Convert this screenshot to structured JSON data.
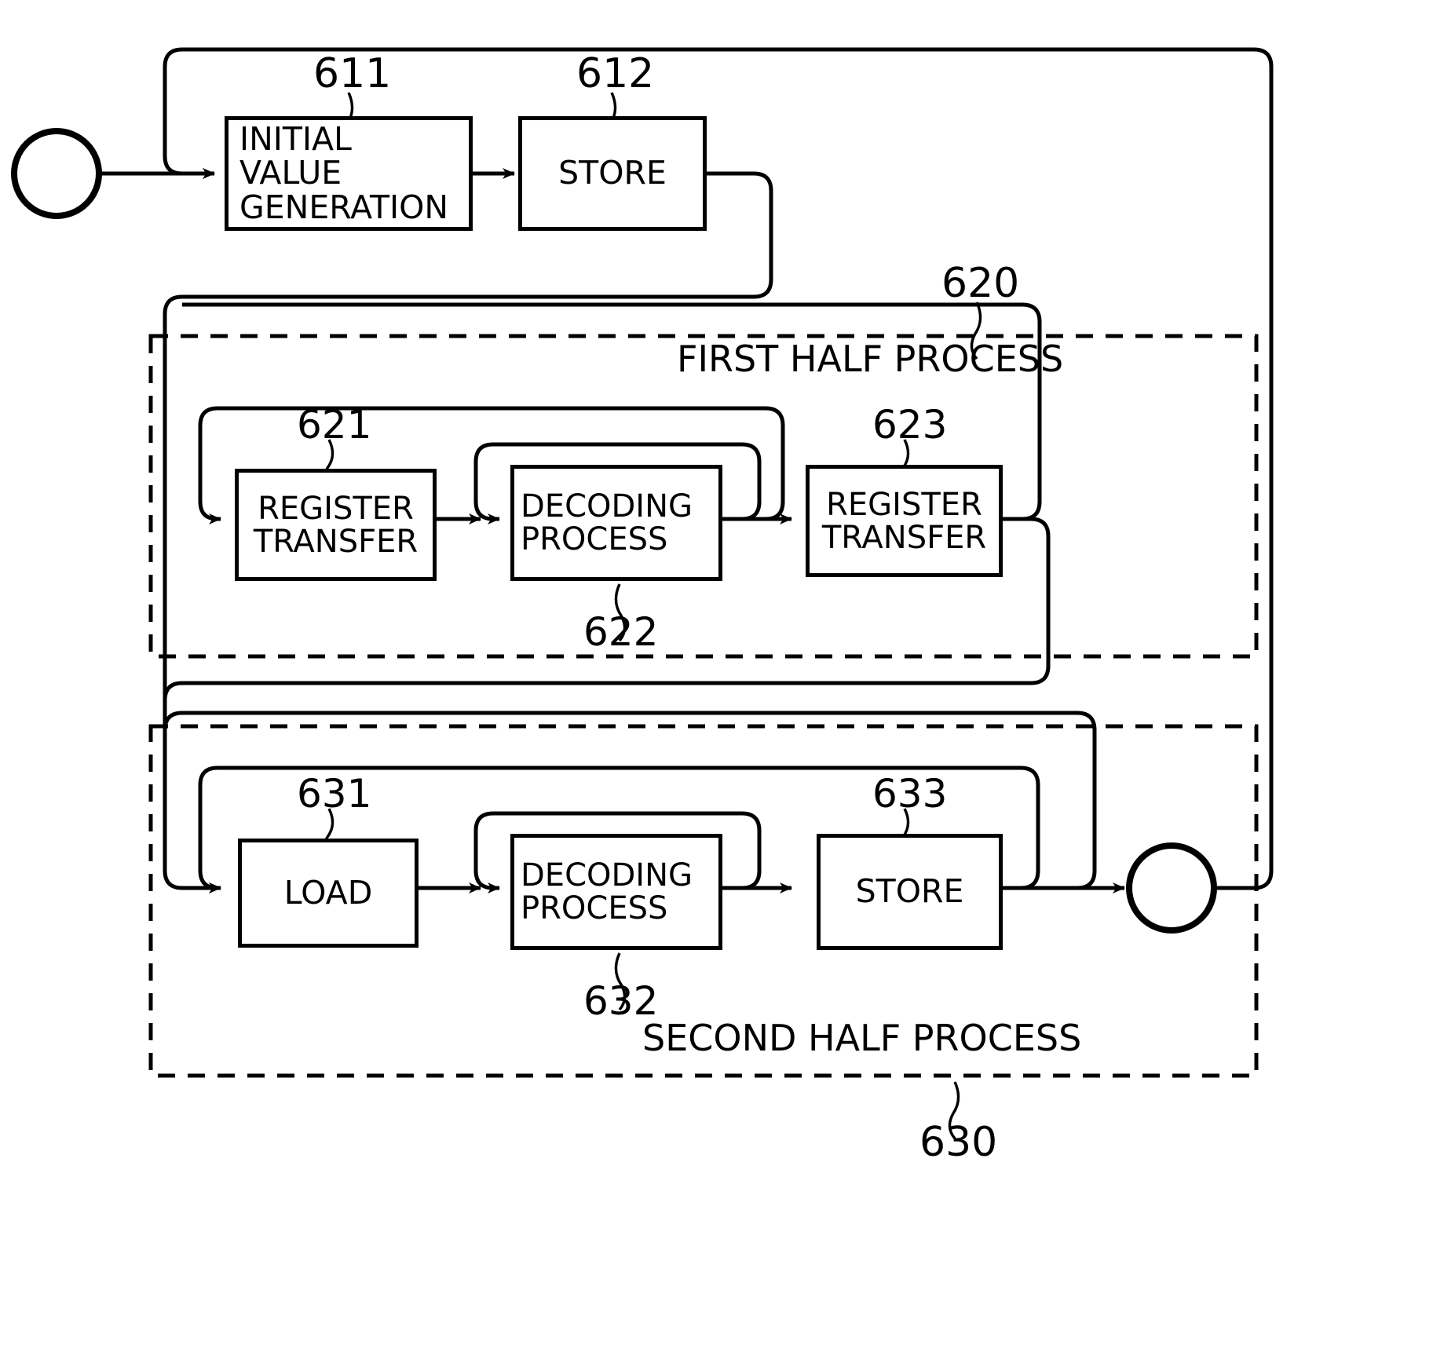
{
  "figure": {
    "kind": "patent-flowchart",
    "line_color": "#000000",
    "background": "#ffffff"
  },
  "terminals": {
    "start": {
      "name": "start-node",
      "label": ""
    },
    "end": {
      "name": "end-node",
      "label": ""
    }
  },
  "groups": [
    {
      "id": "620",
      "label": "FIRST HALF PROCESS",
      "ref": "620"
    },
    {
      "id": "630",
      "label": "SECOND HALF PROCESS",
      "ref": "630"
    }
  ],
  "blocks": [
    {
      "ref": "611",
      "label": "INITIAL\nVALUE\nGENERATION",
      "align": "left"
    },
    {
      "ref": "612",
      "label": "STORE",
      "align": "center"
    },
    {
      "ref": "621",
      "label": "REGISTER\nTRANSFER",
      "align": "center"
    },
    {
      "ref": "622",
      "label": "DECODING\nPROCESS",
      "align": "left"
    },
    {
      "ref": "623",
      "label": "REGISTER\nTRANSFER",
      "align": "center"
    },
    {
      "ref": "631",
      "label": "LOAD",
      "align": "center"
    },
    {
      "ref": "632",
      "label": "DECODING\nPROCESS",
      "align": "left"
    },
    {
      "ref": "633",
      "label": "STORE",
      "align": "center"
    }
  ],
  "ref_numbers": {
    "r611": "611",
    "r612": "612",
    "r620": "620",
    "r621": "621",
    "r622": "622",
    "r623": "623",
    "r630": "630",
    "r631": "631",
    "r632": "632",
    "r633": "633"
  },
  "group_labels": {
    "first_half": "FIRST HALF PROCESS",
    "second_half": "SECOND HALF PROCESS"
  }
}
